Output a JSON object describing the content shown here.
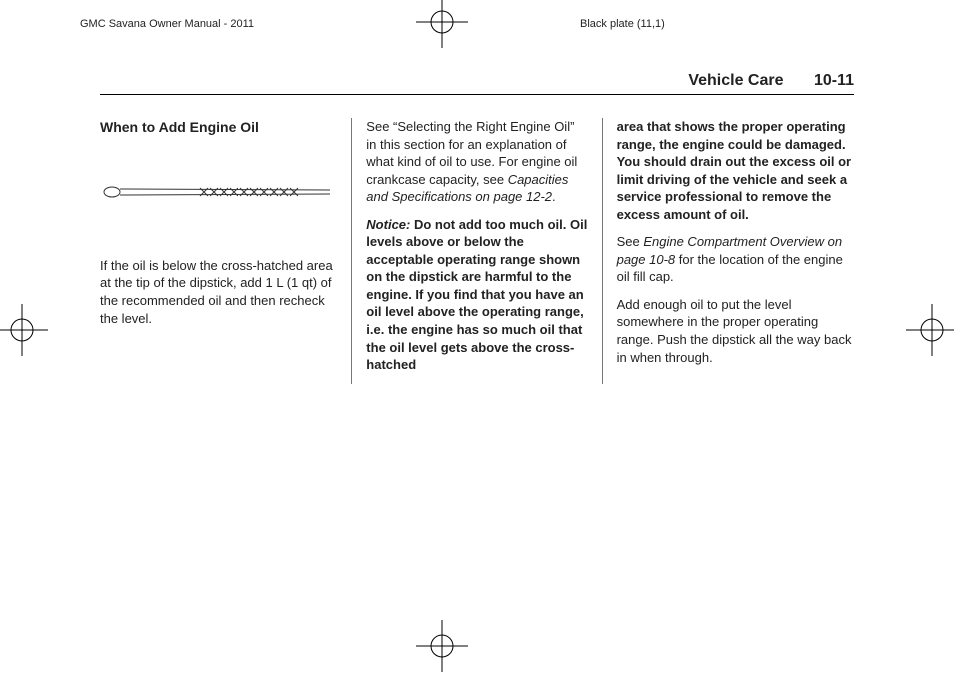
{
  "meta": {
    "manual_title": "GMC Savana Owner Manual - 2011",
    "plate_info": "Black plate (11,1)"
  },
  "header": {
    "section_title": "Vehicle Care",
    "page_number": "10-11"
  },
  "col1": {
    "heading": "When to Add Engine Oil",
    "p1": "If the oil is below the cross-hatched area at the tip of the dipstick, add 1 L (1 qt) of the recommended oil and then recheck the level."
  },
  "col2": {
    "p1_a": "See “Selecting the Right Engine Oil” in this section for an explanation of what kind of oil to use. For engine oil crankcase capacity, see ",
    "p1_italic": "Capacities and Specifications on page 12-2",
    "p1_b": ".",
    "p2_label": "Notice:",
    "p2_body": "Do not add too much oil. Oil levels above or below the acceptable operating range shown on the dipstick are harmful to the engine. If you find that you have an oil level above the operating range, i.e. the engine has so much oil that the oil level gets above the cross-hatched"
  },
  "col3": {
    "p1": "area that shows the proper operating range, the engine could be damaged. You should drain out the excess oil or limit driving of the vehicle and seek a service professional to remove the excess amount of oil.",
    "p2_a": "See ",
    "p2_italic": "Engine Compartment Overview on page 10-8",
    "p2_b": " for the location of the engine oil fill cap.",
    "p3": "Add enough oil to put the level somewhere in the proper operating range. Push the dipstick all the way back in when through."
  }
}
